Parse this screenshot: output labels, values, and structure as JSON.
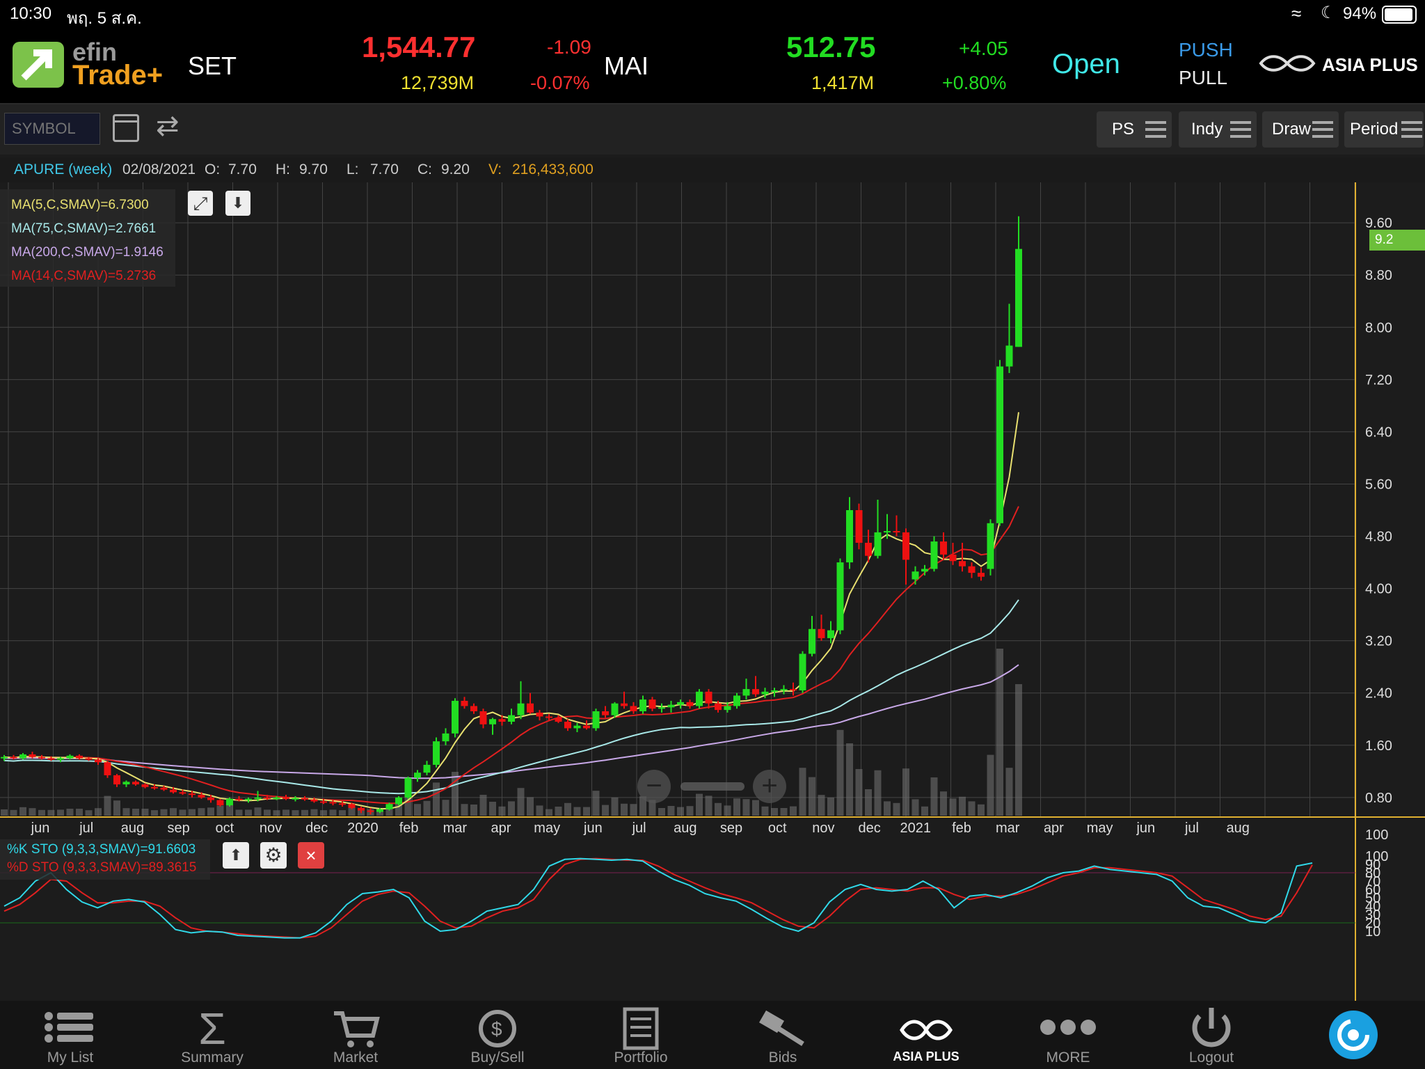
{
  "status": {
    "time": "10:30",
    "date": "พฤ. 5 ส.ค.",
    "battery": "94%"
  },
  "header": {
    "brand_top": "efin",
    "brand_bottom": "Trade+",
    "set_label": "SET",
    "set_index": "1,544.77",
    "set_change": "-1.09",
    "set_value": "12,739M",
    "set_pct": "-0.07%",
    "mai_label": "MAI",
    "mai_index": "512.75",
    "mai_change": "+4.05",
    "mai_value": "1,417M",
    "mai_pct": "+0.80%",
    "market_status": "Open",
    "push": "PUSH",
    "pull": "PULL",
    "broker": "ASIA PLUS"
  },
  "toolbar": {
    "symbol_placeholder": "SYMBOL",
    "ps": "PS",
    "indy": "Indy",
    "draw": "Draw",
    "period": "Period"
  },
  "info": {
    "symbol": "APURE (week)",
    "date": "02/08/2021",
    "o_label": "O:",
    "o": "7.70",
    "h_label": "H:",
    "h": "9.70",
    "l_label": "L:",
    "l": "7.70",
    "c_label": "C:",
    "c": "9.20",
    "v_label": "V:",
    "v": "216,433,600"
  },
  "indicators": {
    "ma5": "MA(5,C,SMAV)=6.7300",
    "ma75": "MA(75,C,SMAV)=2.7661",
    "ma200": "MA(200,C,SMAV)=1.9146",
    "ma14": "MA(14,C,SMAV)=5.2736",
    "k": "%K STO (9,3,3,SMAV)=91.6603",
    "d": "%D STO (9,3,3,SMAV)=89.3615",
    "last_price_tag": "9.2"
  },
  "colors": {
    "up": "#22dd22",
    "down": "#ee1111",
    "ma5": "#e8e070",
    "ma75": "#a8e8e8",
    "ma200": "#c8a8e8",
    "ma14": "#e02020",
    "k": "#30d8e8",
    "d": "#e02020",
    "axis": "#e0b030"
  },
  "chart_data": [
    {
      "type": "candlestick",
      "title": "APURE (week)",
      "x_ticks": [
        "jun",
        "jul",
        "aug",
        "sep",
        "oct",
        "nov",
        "dec",
        "2020",
        "feb",
        "mar",
        "apr",
        "may",
        "jun",
        "jul",
        "aug",
        "sep",
        "oct",
        "nov",
        "dec",
        "2021",
        "feb",
        "mar",
        "apr",
        "may",
        "jun",
        "jul",
        "aug"
      ],
      "y_ticks": [
        "0.80",
        "1.60",
        "2.40",
        "3.20",
        "4.00",
        "4.80",
        "5.60",
        "6.40",
        "7.20",
        "8.00",
        "8.80",
        "9.60"
      ],
      "ylim": [
        0.5,
        9.9
      ],
      "candles": [
        {
          "o": 1.4,
          "h": 1.45,
          "l": 1.36,
          "c": 1.42
        },
        {
          "o": 1.42,
          "h": 1.45,
          "l": 1.38,
          "c": 1.4
        },
        {
          "o": 1.4,
          "h": 1.48,
          "l": 1.38,
          "c": 1.46
        },
        {
          "o": 1.46,
          "h": 1.5,
          "l": 1.4,
          "c": 1.42
        },
        {
          "o": 1.42,
          "h": 1.45,
          "l": 1.38,
          "c": 1.4
        },
        {
          "o": 1.4,
          "h": 1.43,
          "l": 1.36,
          "c": 1.38
        },
        {
          "o": 1.38,
          "h": 1.42,
          "l": 1.34,
          "c": 1.4
        },
        {
          "o": 1.4,
          "h": 1.46,
          "l": 1.38,
          "c": 1.44
        },
        {
          "o": 1.44,
          "h": 1.46,
          "l": 1.38,
          "c": 1.4
        },
        {
          "o": 1.4,
          "h": 1.42,
          "l": 1.36,
          "c": 1.38
        },
        {
          "o": 1.38,
          "h": 1.4,
          "l": 1.3,
          "c": 1.34
        },
        {
          "o": 1.34,
          "h": 1.36,
          "l": 1.1,
          "c": 1.14
        },
        {
          "o": 1.14,
          "h": 1.16,
          "l": 0.96,
          "c": 1.0
        },
        {
          "o": 1.0,
          "h": 1.06,
          "l": 0.96,
          "c": 1.04
        },
        {
          "o": 1.04,
          "h": 1.06,
          "l": 0.98,
          "c": 1.0
        },
        {
          "o": 1.0,
          "h": 1.02,
          "l": 0.94,
          "c": 0.96
        },
        {
          "o": 0.96,
          "h": 1.0,
          "l": 0.92,
          "c": 0.95
        },
        {
          "o": 0.95,
          "h": 0.98,
          "l": 0.9,
          "c": 0.92
        },
        {
          "o": 0.92,
          "h": 0.96,
          "l": 0.86,
          "c": 0.88
        },
        {
          "o": 0.88,
          "h": 0.92,
          "l": 0.84,
          "c": 0.86
        },
        {
          "o": 0.86,
          "h": 0.9,
          "l": 0.8,
          "c": 0.84
        },
        {
          "o": 0.84,
          "h": 0.88,
          "l": 0.78,
          "c": 0.8
        },
        {
          "o": 0.8,
          "h": 0.84,
          "l": 0.72,
          "c": 0.76
        },
        {
          "o": 0.76,
          "h": 0.78,
          "l": 0.66,
          "c": 0.68
        },
        {
          "o": 0.68,
          "h": 0.8,
          "l": 0.66,
          "c": 0.78
        },
        {
          "o": 0.78,
          "h": 0.82,
          "l": 0.74,
          "c": 0.76
        },
        {
          "o": 0.76,
          "h": 0.8,
          "l": 0.72,
          "c": 0.78
        },
        {
          "o": 0.78,
          "h": 0.9,
          "l": 0.74,
          "c": 0.8
        },
        {
          "o": 0.8,
          "h": 0.84,
          "l": 0.76,
          "c": 0.78
        },
        {
          "o": 0.78,
          "h": 0.82,
          "l": 0.76,
          "c": 0.8
        },
        {
          "o": 0.8,
          "h": 0.84,
          "l": 0.76,
          "c": 0.78
        },
        {
          "o": 0.78,
          "h": 0.82,
          "l": 0.74,
          "c": 0.79
        },
        {
          "o": 0.79,
          "h": 0.82,
          "l": 0.75,
          "c": 0.77
        },
        {
          "o": 0.77,
          "h": 0.8,
          "l": 0.72,
          "c": 0.74
        },
        {
          "o": 0.74,
          "h": 0.78,
          "l": 0.7,
          "c": 0.73
        },
        {
          "o": 0.73,
          "h": 0.76,
          "l": 0.68,
          "c": 0.71
        },
        {
          "o": 0.71,
          "h": 0.74,
          "l": 0.66,
          "c": 0.7
        },
        {
          "o": 0.7,
          "h": 0.72,
          "l": 0.62,
          "c": 0.64
        },
        {
          "o": 0.64,
          "h": 0.66,
          "l": 0.56,
          "c": 0.6
        },
        {
          "o": 0.6,
          "h": 0.64,
          "l": 0.54,
          "c": 0.58
        },
        {
          "o": 0.58,
          "h": 0.64,
          "l": 0.56,
          "c": 0.62
        },
        {
          "o": 0.62,
          "h": 0.72,
          "l": 0.6,
          "c": 0.7
        },
        {
          "o": 0.7,
          "h": 0.82,
          "l": 0.68,
          "c": 0.8
        },
        {
          "o": 0.8,
          "h": 1.12,
          "l": 0.78,
          "c": 1.1
        },
        {
          "o": 1.1,
          "h": 1.22,
          "l": 1.04,
          "c": 1.18
        },
        {
          "o": 1.18,
          "h": 1.36,
          "l": 1.14,
          "c": 1.3
        },
        {
          "o": 1.3,
          "h": 1.72,
          "l": 1.26,
          "c": 1.66
        },
        {
          "o": 1.66,
          "h": 1.86,
          "l": 1.6,
          "c": 1.78
        },
        {
          "o": 1.78,
          "h": 2.32,
          "l": 1.72,
          "c": 2.28
        },
        {
          "o": 2.28,
          "h": 2.34,
          "l": 2.16,
          "c": 2.2
        },
        {
          "o": 2.2,
          "h": 2.24,
          "l": 2.08,
          "c": 2.12
        },
        {
          "o": 2.12,
          "h": 2.16,
          "l": 1.86,
          "c": 1.92
        },
        {
          "o": 1.92,
          "h": 2.02,
          "l": 1.76,
          "c": 2.0
        },
        {
          "o": 2.0,
          "h": 2.06,
          "l": 1.9,
          "c": 1.96
        },
        {
          "o": 1.96,
          "h": 2.16,
          "l": 1.92,
          "c": 2.06
        },
        {
          "o": 2.06,
          "h": 2.58,
          "l": 2.0,
          "c": 2.24
        },
        {
          "o": 2.24,
          "h": 2.4,
          "l": 2.08,
          "c": 2.1
        },
        {
          "o": 2.1,
          "h": 2.14,
          "l": 1.98,
          "c": 2.04
        },
        {
          "o": 2.04,
          "h": 2.08,
          "l": 1.98,
          "c": 2.02
        },
        {
          "o": 2.02,
          "h": 2.06,
          "l": 1.94,
          "c": 1.96
        },
        {
          "o": 1.96,
          "h": 2.0,
          "l": 1.82,
          "c": 1.86
        },
        {
          "o": 1.86,
          "h": 1.94,
          "l": 1.8,
          "c": 1.9
        },
        {
          "o": 1.9,
          "h": 1.98,
          "l": 1.84,
          "c": 1.86
        },
        {
          "o": 1.86,
          "h": 2.16,
          "l": 1.82,
          "c": 2.12
        },
        {
          "o": 2.12,
          "h": 2.2,
          "l": 2.02,
          "c": 2.06
        },
        {
          "o": 2.06,
          "h": 2.26,
          "l": 2.02,
          "c": 2.24
        },
        {
          "o": 2.24,
          "h": 2.42,
          "l": 2.16,
          "c": 2.2
        },
        {
          "o": 2.2,
          "h": 2.26,
          "l": 2.08,
          "c": 2.12
        },
        {
          "o": 2.12,
          "h": 2.36,
          "l": 2.08,
          "c": 2.3
        },
        {
          "o": 2.3,
          "h": 2.34,
          "l": 2.12,
          "c": 2.16
        },
        {
          "o": 2.16,
          "h": 2.24,
          "l": 2.1,
          "c": 2.18
        },
        {
          "o": 2.18,
          "h": 2.28,
          "l": 2.1,
          "c": 2.22
        },
        {
          "o": 2.22,
          "h": 2.3,
          "l": 2.16,
          "c": 2.26
        },
        {
          "o": 2.26,
          "h": 2.3,
          "l": 2.16,
          "c": 2.2
        },
        {
          "o": 2.2,
          "h": 2.46,
          "l": 2.16,
          "c": 2.42
        },
        {
          "o": 2.42,
          "h": 2.46,
          "l": 2.16,
          "c": 2.24
        },
        {
          "o": 2.24,
          "h": 2.28,
          "l": 2.1,
          "c": 2.14
        },
        {
          "o": 2.14,
          "h": 2.26,
          "l": 2.1,
          "c": 2.2
        },
        {
          "o": 2.2,
          "h": 2.4,
          "l": 2.16,
          "c": 2.36
        },
        {
          "o": 2.36,
          "h": 2.62,
          "l": 2.3,
          "c": 2.46
        },
        {
          "o": 2.46,
          "h": 2.66,
          "l": 2.34,
          "c": 2.38
        },
        {
          "o": 2.38,
          "h": 2.48,
          "l": 2.32,
          "c": 2.42
        },
        {
          "o": 2.42,
          "h": 2.48,
          "l": 2.34,
          "c": 2.44
        },
        {
          "o": 2.44,
          "h": 2.52,
          "l": 2.38,
          "c": 2.46
        },
        {
          "o": 2.46,
          "h": 2.56,
          "l": 2.36,
          "c": 2.44
        },
        {
          "o": 2.44,
          "h": 3.04,
          "l": 2.4,
          "c": 3.0
        },
        {
          "o": 3.0,
          "h": 3.58,
          "l": 2.96,
          "c": 3.38
        },
        {
          "o": 3.38,
          "h": 3.6,
          "l": 3.2,
          "c": 3.24
        },
        {
          "o": 3.24,
          "h": 3.5,
          "l": 3.16,
          "c": 3.36
        },
        {
          "o": 3.36,
          "h": 4.46,
          "l": 3.3,
          "c": 4.4
        },
        {
          "o": 4.4,
          "h": 5.4,
          "l": 4.3,
          "c": 5.2
        },
        {
          "o": 5.2,
          "h": 5.3,
          "l": 4.6,
          "c": 4.7
        },
        {
          "o": 4.7,
          "h": 4.9,
          "l": 4.4,
          "c": 4.5
        },
        {
          "o": 4.5,
          "h": 5.36,
          "l": 4.46,
          "c": 4.86
        },
        {
          "o": 4.86,
          "h": 5.14,
          "l": 4.76,
          "c": 4.88
        },
        {
          "o": 4.88,
          "h": 5.12,
          "l": 4.8,
          "c": 4.86
        },
        {
          "o": 4.86,
          "h": 4.92,
          "l": 4.06,
          "c": 4.44
        },
        {
          "o": 4.14,
          "h": 4.34,
          "l": 4.06,
          "c": 4.26
        },
        {
          "o": 4.26,
          "h": 4.36,
          "l": 4.2,
          "c": 4.3
        },
        {
          "o": 4.3,
          "h": 4.8,
          "l": 4.26,
          "c": 4.72
        },
        {
          "o": 4.72,
          "h": 4.86,
          "l": 4.44,
          "c": 4.52
        },
        {
          "o": 4.52,
          "h": 4.7,
          "l": 4.36,
          "c": 4.42
        },
        {
          "o": 4.42,
          "h": 4.7,
          "l": 4.26,
          "c": 4.34
        },
        {
          "o": 4.34,
          "h": 4.4,
          "l": 4.16,
          "c": 4.24
        },
        {
          "o": 4.24,
          "h": 4.32,
          "l": 4.12,
          "c": 4.18
        },
        {
          "o": 4.3,
          "h": 5.06,
          "l": 4.2,
          "c": 5.0
        },
        {
          "o": 5.0,
          "h": 7.5,
          "l": 4.96,
          "c": 7.4
        },
        {
          "o": 7.4,
          "h": 8.36,
          "l": 7.3,
          "c": 7.72
        },
        {
          "o": 7.7,
          "h": 9.7,
          "l": 7.7,
          "c": 9.2
        }
      ],
      "ma5_last": 6.73,
      "ma14_last": 5.2736,
      "ma75_last": 2.7661,
      "ma200_last": 1.9146
    },
    {
      "type": "line",
      "title": "STO",
      "y_ticks": [
        "10",
        "20",
        "30",
        "40",
        "50",
        "60",
        "70",
        "80",
        "90",
        "100"
      ],
      "ylim": [
        0,
        100
      ],
      "k": [
        40,
        50,
        70,
        80,
        60,
        45,
        38,
        46,
        48,
        45,
        30,
        12,
        8,
        10,
        9,
        5,
        4,
        3,
        2,
        2,
        8,
        22,
        42,
        55,
        57,
        60,
        50,
        22,
        10,
        12,
        22,
        34,
        38,
        42,
        60,
        88,
        96,
        97,
        96,
        95,
        96,
        94,
        82,
        72,
        65,
        55,
        50,
        46,
        36,
        25,
        15,
        10,
        20,
        45,
        60,
        66,
        60,
        58,
        60,
        70,
        60,
        38,
        52,
        54,
        50,
        56,
        64,
        74,
        80,
        82,
        88,
        84,
        82,
        80,
        78,
        70,
        50,
        40,
        38,
        30,
        22,
        20,
        32,
        88,
        91.66
      ],
      "d": [
        34,
        42,
        56,
        72,
        70,
        56,
        44,
        44,
        46,
        46,
        40,
        26,
        14,
        10,
        9,
        7,
        5,
        4,
        3,
        2,
        4,
        14,
        30,
        46,
        54,
        58,
        56,
        40,
        22,
        14,
        16,
        26,
        34,
        38,
        48,
        72,
        90,
        96,
        97,
        96,
        95,
        95,
        88,
        78,
        70,
        62,
        55,
        50,
        44,
        34,
        24,
        16,
        14,
        28,
        46,
        60,
        62,
        60,
        58,
        62,
        62,
        54,
        48,
        52,
        52,
        54,
        60,
        68,
        76,
        80,
        86,
        86,
        84,
        82,
        80,
        76,
        62,
        48,
        42,
        36,
        28,
        24,
        28,
        56,
        89.36
      ]
    }
  ],
  "volume_label": "100",
  "nav": [
    "My List",
    "Summary",
    "Market",
    "Buy/Sell",
    "Portfolio",
    "Bids",
    "ASIA PLUS",
    "MORE",
    "Logout"
  ]
}
